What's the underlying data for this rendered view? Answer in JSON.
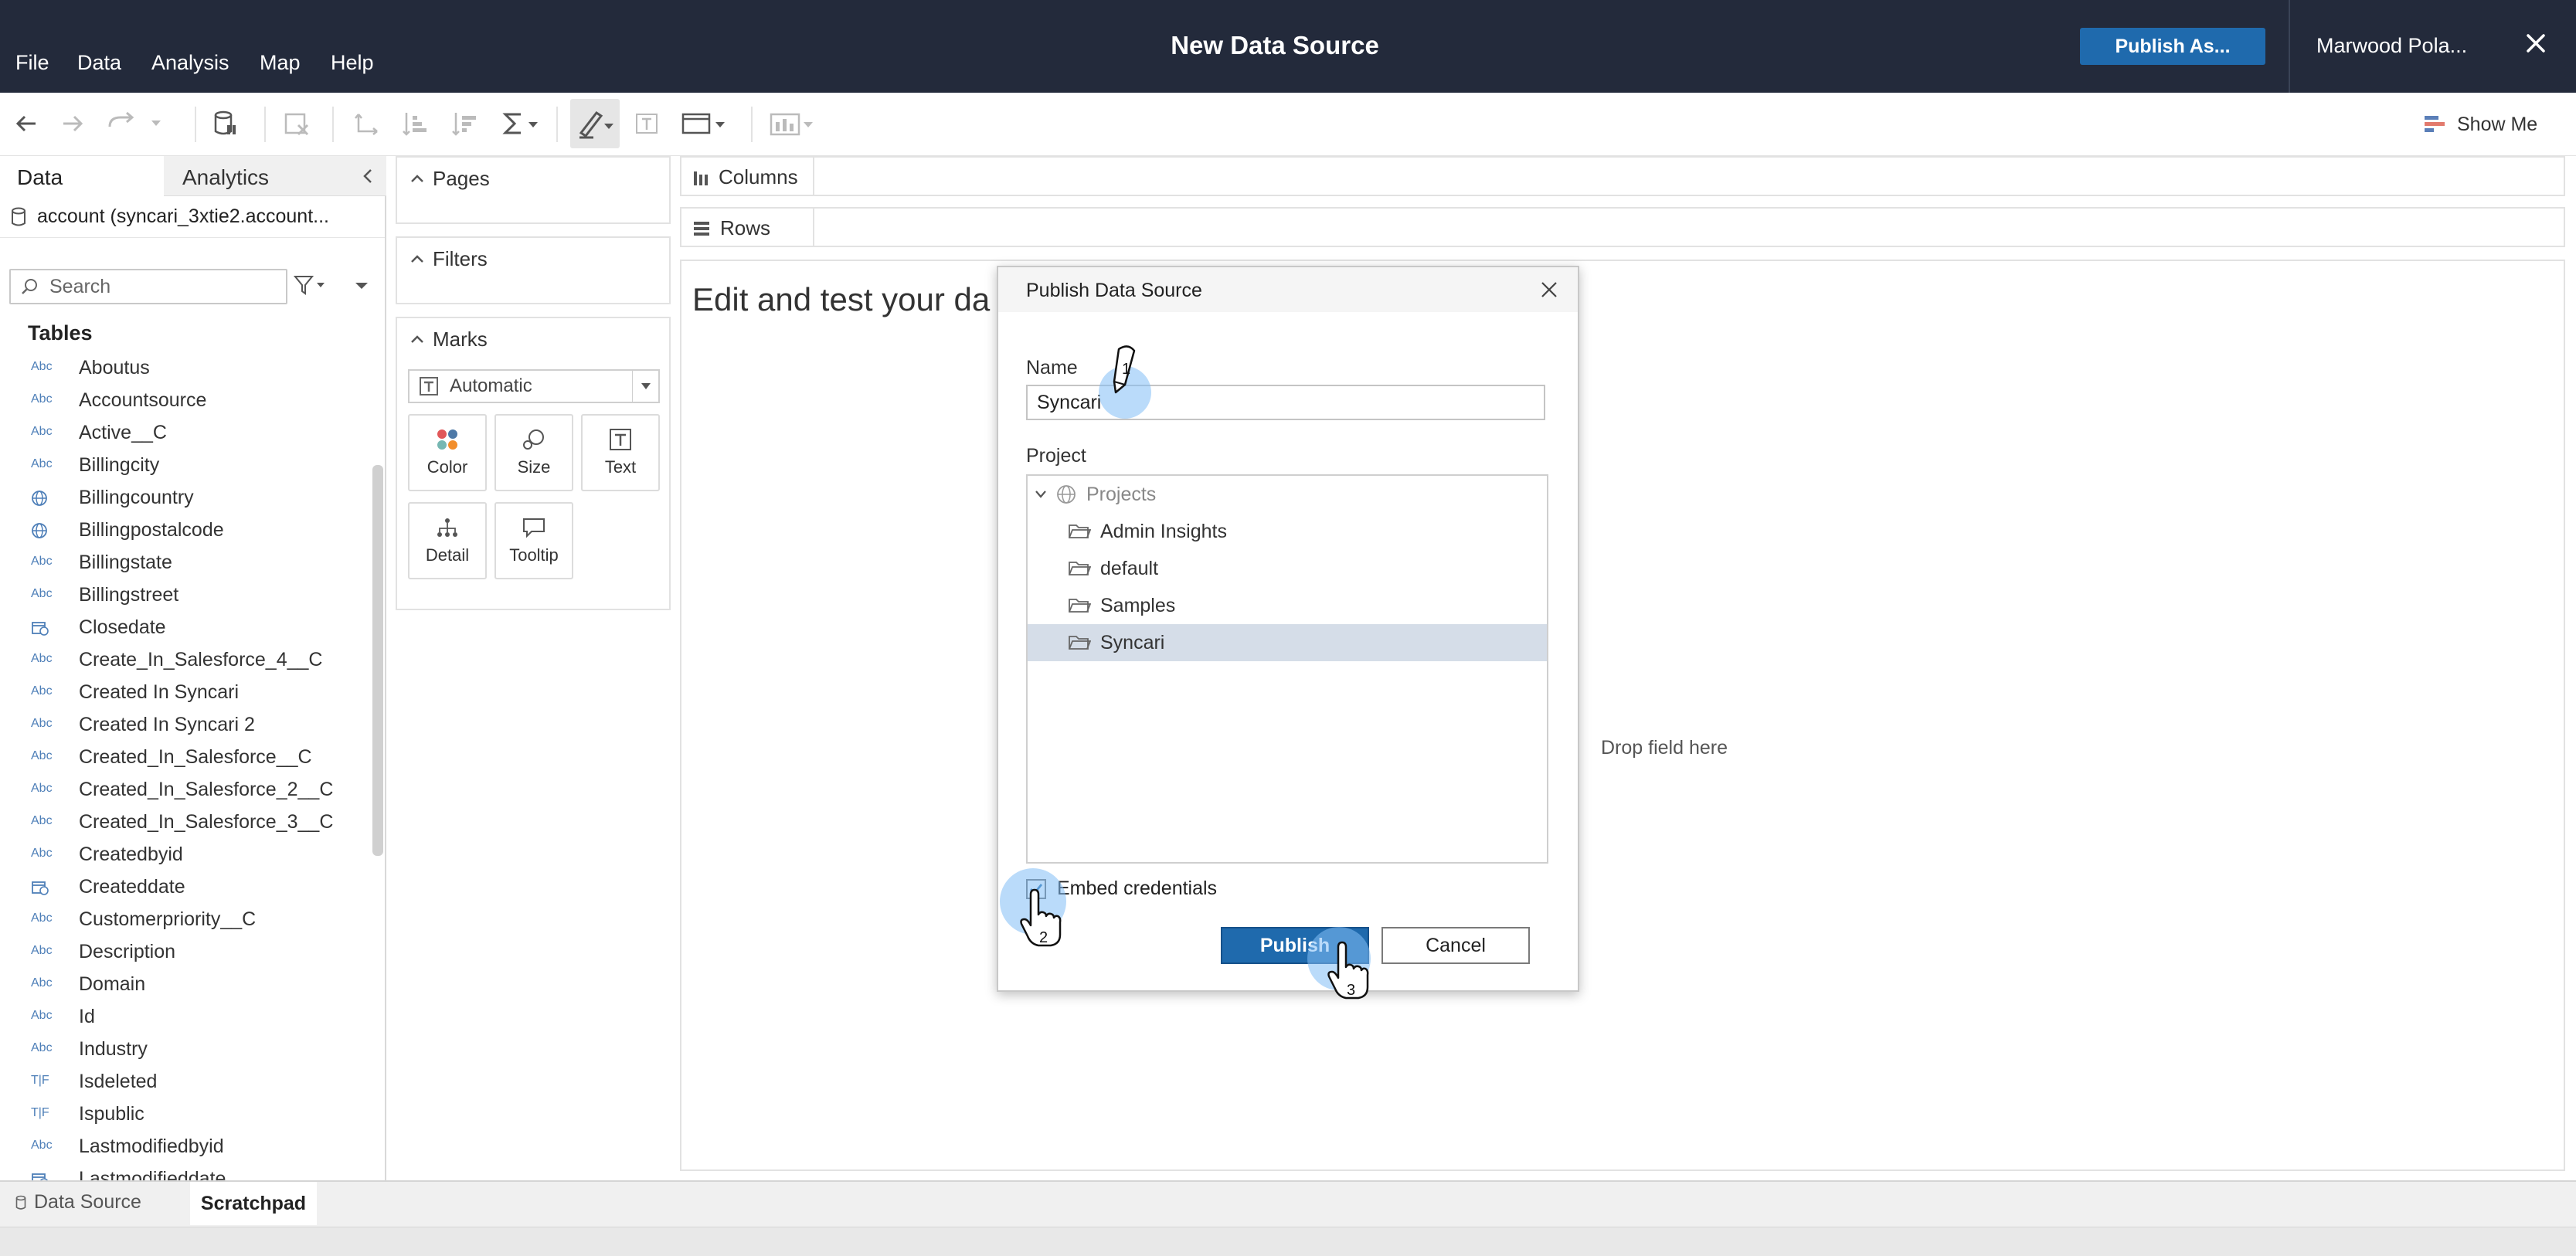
{
  "menu": {
    "items": [
      "File",
      "Data",
      "Analysis",
      "Map",
      "Help"
    ]
  },
  "app": {
    "title": "New Data Source"
  },
  "header": {
    "publish_as_label": "Publish As...",
    "user_name": "Marwood Pola..."
  },
  "toolbar": {
    "show_me_label": "Show Me"
  },
  "data_pane": {
    "tab_data": "Data",
    "tab_analytics": "Analytics",
    "datasource_label": "account (syncari_3xtie2.account...",
    "search_placeholder": "Search",
    "tables_heading": "Tables",
    "fields": [
      {
        "type": "Abc",
        "name": "Aboutus"
      },
      {
        "type": "Abc",
        "name": "Accountsource"
      },
      {
        "type": "Abc",
        "name": "Active__C"
      },
      {
        "type": "Abc",
        "name": "Billingcity"
      },
      {
        "type": "geo",
        "name": "Billingcountry"
      },
      {
        "type": "geo",
        "name": "Billingpostalcode"
      },
      {
        "type": "Abc",
        "name": "Billingstate"
      },
      {
        "type": "Abc",
        "name": "Billingstreet"
      },
      {
        "type": "date",
        "name": "Closedate"
      },
      {
        "type": "Abc",
        "name": "Create_In_Salesforce_4__C"
      },
      {
        "type": "Abc",
        "name": "Created In Syncari"
      },
      {
        "type": "Abc",
        "name": "Created In Syncari 2"
      },
      {
        "type": "Abc",
        "name": "Created_In_Salesforce__C"
      },
      {
        "type": "Abc",
        "name": "Created_In_Salesforce_2__C"
      },
      {
        "type": "Abc",
        "name": "Created_In_Salesforce_3__C"
      },
      {
        "type": "Abc",
        "name": "Createdbyid"
      },
      {
        "type": "date",
        "name": "Createddate"
      },
      {
        "type": "Abc",
        "name": "Customerpriority__C"
      },
      {
        "type": "Abc",
        "name": "Description"
      },
      {
        "type": "Abc",
        "name": "Domain"
      },
      {
        "type": "Abc",
        "name": "Id"
      },
      {
        "type": "Abc",
        "name": "Industry"
      },
      {
        "type": "T|F",
        "name": "Isdeleted"
      },
      {
        "type": "T|F",
        "name": "Ispublic"
      },
      {
        "type": "Abc",
        "name": "Lastmodifiedbyid"
      },
      {
        "type": "date",
        "name": "Lastmodifieddate"
      }
    ]
  },
  "shelves": {
    "pages": "Pages",
    "filters": "Filters",
    "marks": "Marks",
    "marks_type": "Automatic",
    "mark_buttons": [
      "Color",
      "Size",
      "Text",
      "Detail",
      "Tooltip"
    ],
    "columns": "Columns",
    "rows": "Rows"
  },
  "canvas": {
    "title": "Edit and test your da",
    "drop_hint": "Drop field here"
  },
  "bottom_tabs": {
    "data_source": "Data Source",
    "scratchpad": "Scratchpad"
  },
  "dialog": {
    "title": "Publish Data Source",
    "name_label": "Name",
    "name_value": "Syncari",
    "project_label": "Project",
    "tree": [
      {
        "label": "Projects",
        "level": 0,
        "selected": false
      },
      {
        "label": "Admin Insights",
        "level": 1,
        "selected": false
      },
      {
        "label": "default",
        "level": 1,
        "selected": false
      },
      {
        "label": "Samples",
        "level": 1,
        "selected": false
      },
      {
        "label": "Syncari",
        "level": 1,
        "selected": true
      }
    ],
    "embed_label": "Embed credentials",
    "embed_checked": true,
    "publish_label": "Publish",
    "cancel_label": "Cancel"
  },
  "annotations": {
    "step1": "1",
    "step2": "2",
    "step3": "3"
  },
  "colors": {
    "topbar": "#232a3b",
    "accent": "#1f6aad",
    "selected_row": "#d5dde8",
    "step_highlight": "#82bef5"
  }
}
